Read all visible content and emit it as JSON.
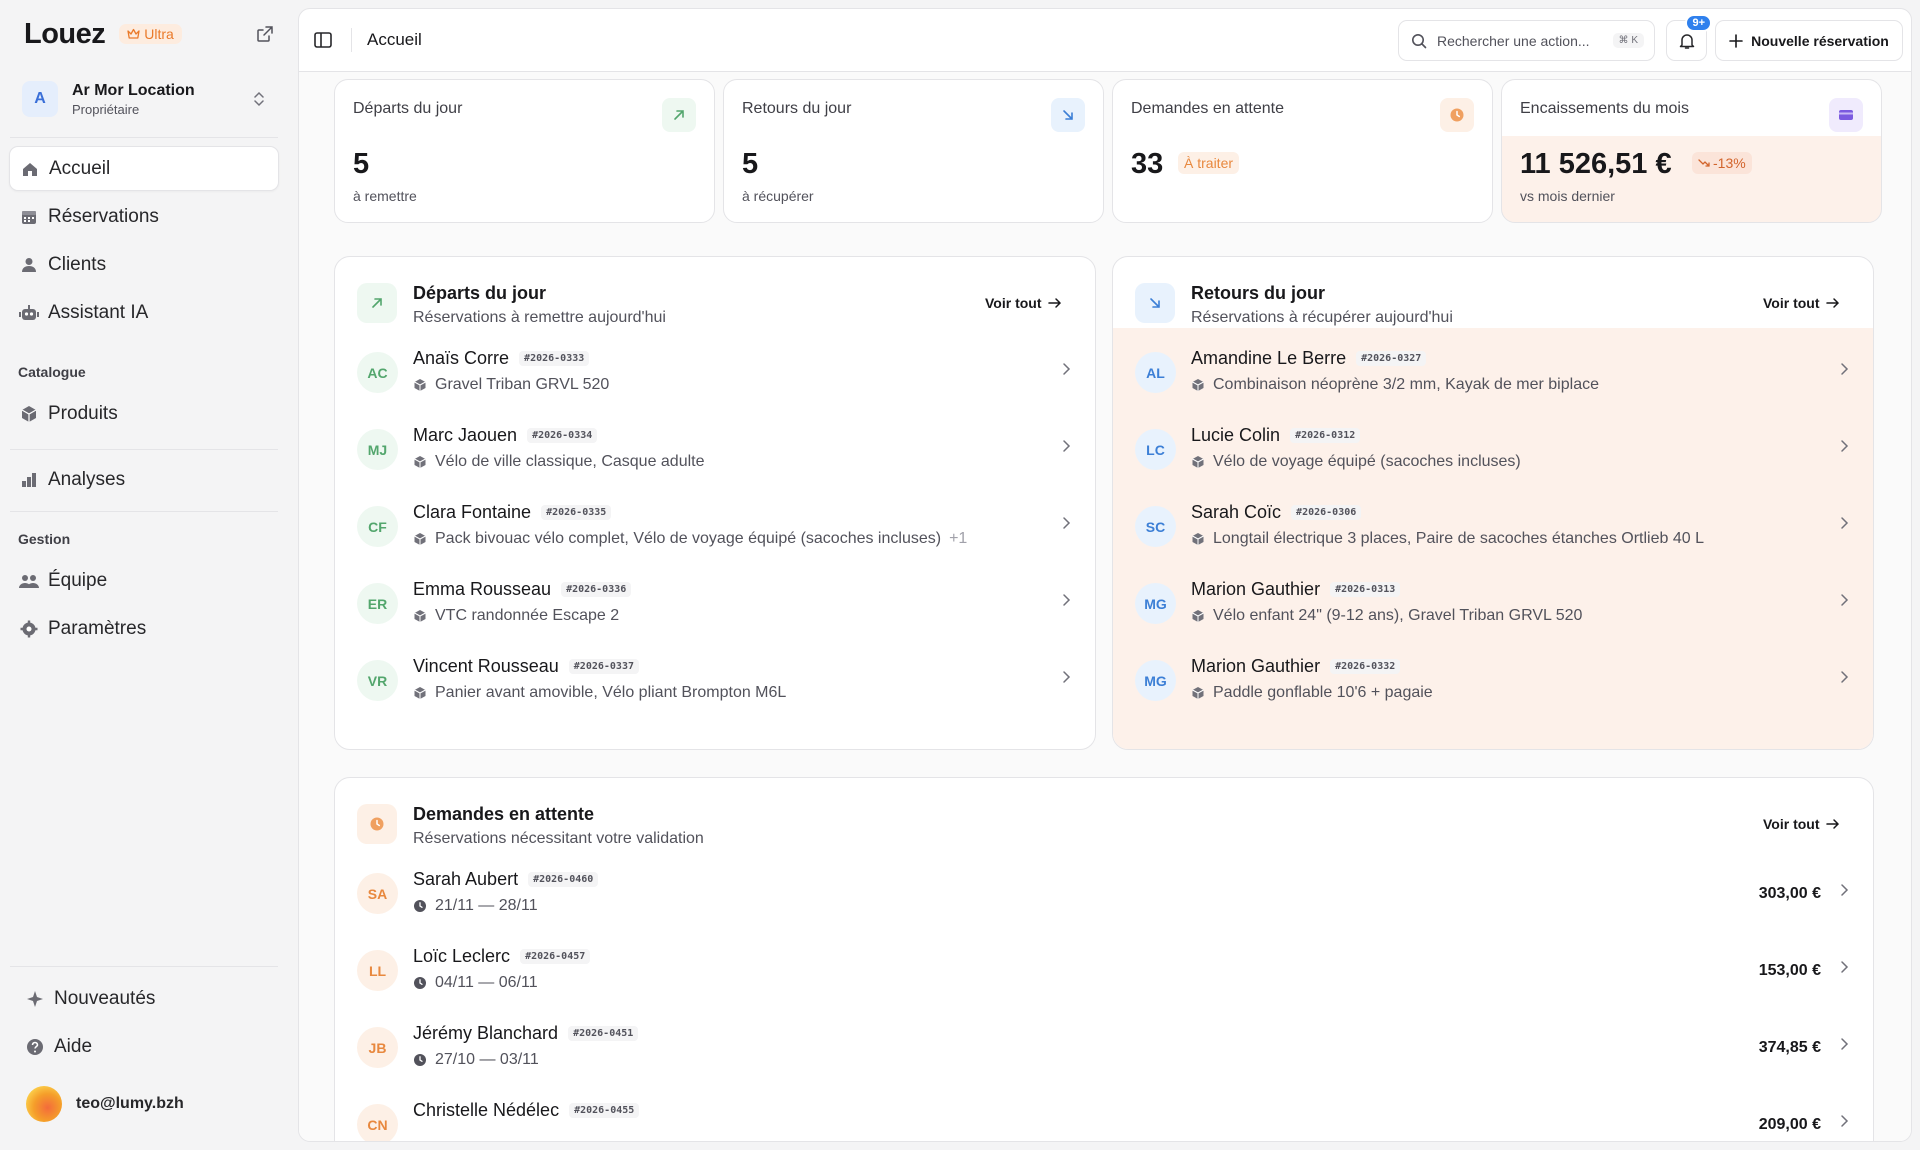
{
  "app": {
    "logo": "Louez",
    "plan": "Ultra"
  },
  "org": {
    "initial": "A",
    "name": "Ar Mor Location",
    "role": "Propriétaire"
  },
  "nav": {
    "accueil": "Accueil",
    "reservations": "Réservations",
    "clients": "Clients",
    "assistant": "Assistant IA",
    "catalogue_label": "Catalogue",
    "produits": "Produits",
    "analyses": "Analyses",
    "gestion_label": "Gestion",
    "equipe": "Équipe",
    "parametres": "Paramètres"
  },
  "footer_nav": {
    "nouveautes": "Nouveautés",
    "aide": "Aide"
  },
  "user": {
    "email": "teo@lumy.bzh"
  },
  "topbar": {
    "breadcrumb": "Accueil",
    "search_placeholder": "Rechercher une action...",
    "search_shortcut": "⌘ K",
    "notif_count": "9+",
    "new_reservation": "Nouvelle réservation"
  },
  "stats": [
    {
      "title": "Départs du jour",
      "value": "5",
      "sub": "à remettre",
      "icon": "arrow-up-right-icon"
    },
    {
      "title": "Retours du jour",
      "value": "5",
      "sub": "à récupérer",
      "icon": "arrow-down-right-icon"
    },
    {
      "title": "Demandes en attente",
      "value": "33",
      "badge": "À traiter",
      "icon": "clock-icon"
    },
    {
      "title": "Encaissements du mois",
      "value": "11 526,51 €",
      "delta": "-13%",
      "sub": "vs mois dernier",
      "icon": "wallet-icon"
    }
  ],
  "departures": {
    "title": "Départs du jour",
    "subtitle": "Réservations à remettre aujourd'hui",
    "view_all": "Voir tout",
    "rows": [
      {
        "initials": "AC",
        "name": "Anaïs Corre",
        "ref": "#2026-0333",
        "items": "Gravel Triban GRVL 520"
      },
      {
        "initials": "MJ",
        "name": "Marc Jaouen",
        "ref": "#2026-0334",
        "items": "Vélo de ville classique, Casque adulte"
      },
      {
        "initials": "CF",
        "name": "Clara Fontaine",
        "ref": "#2026-0335",
        "items": "Pack bivouac vélo complet, Vélo de voyage équipé (sacoches incluses)",
        "extra": "+1"
      },
      {
        "initials": "ER",
        "name": "Emma Rousseau",
        "ref": "#2026-0336",
        "items": "VTC randonnée Escape 2"
      },
      {
        "initials": "VR",
        "name": "Vincent Rousseau",
        "ref": "#2026-0337",
        "items": "Panier avant amovible, Vélo pliant Brompton M6L"
      }
    ]
  },
  "returns": {
    "title": "Retours du jour",
    "subtitle": "Réservations à récupérer aujourd'hui",
    "view_all": "Voir tout",
    "rows": [
      {
        "initials": "AL",
        "name": "Amandine Le Berre",
        "ref": "#2026-0327",
        "items": "Combinaison néoprène 3/2 mm, Kayak de mer biplace"
      },
      {
        "initials": "LC",
        "name": "Lucie Colin",
        "ref": "#2026-0312",
        "items": "Vélo de voyage équipé (sacoches incluses)"
      },
      {
        "initials": "SC",
        "name": "Sarah Coïc",
        "ref": "#2026-0306",
        "items": "Longtail électrique 3 places, Paire de sacoches étanches Ortlieb 40 L"
      },
      {
        "initials": "MG",
        "name": "Marion Gauthier",
        "ref": "#2026-0313",
        "items": "Vélo enfant 24\" (9-12 ans), Gravel Triban GRVL 520"
      },
      {
        "initials": "MG",
        "name": "Marion Gauthier",
        "ref": "#2026-0332",
        "items": "Paddle gonflable 10'6 + pagaie"
      }
    ]
  },
  "pending": {
    "title": "Demandes en attente",
    "subtitle": "Réservations nécessitant votre validation",
    "view_all": "Voir tout",
    "rows": [
      {
        "initials": "SA",
        "name": "Sarah Aubert",
        "ref": "#2026-0460",
        "dates": "21/11 — 28/11",
        "price": "303,00 €"
      },
      {
        "initials": "LL",
        "name": "Loïc Leclerc",
        "ref": "#2026-0457",
        "dates": "04/11 — 06/11",
        "price": "153,00 €"
      },
      {
        "initials": "JB",
        "name": "Jérémy Blanchard",
        "ref": "#2026-0451",
        "dates": "27/10 — 03/11",
        "price": "374,85 €"
      },
      {
        "initials": "CN",
        "name": "Christelle Nédélec",
        "ref": "#2026-0455",
        "dates": "",
        "price": "209,00 €"
      }
    ]
  }
}
